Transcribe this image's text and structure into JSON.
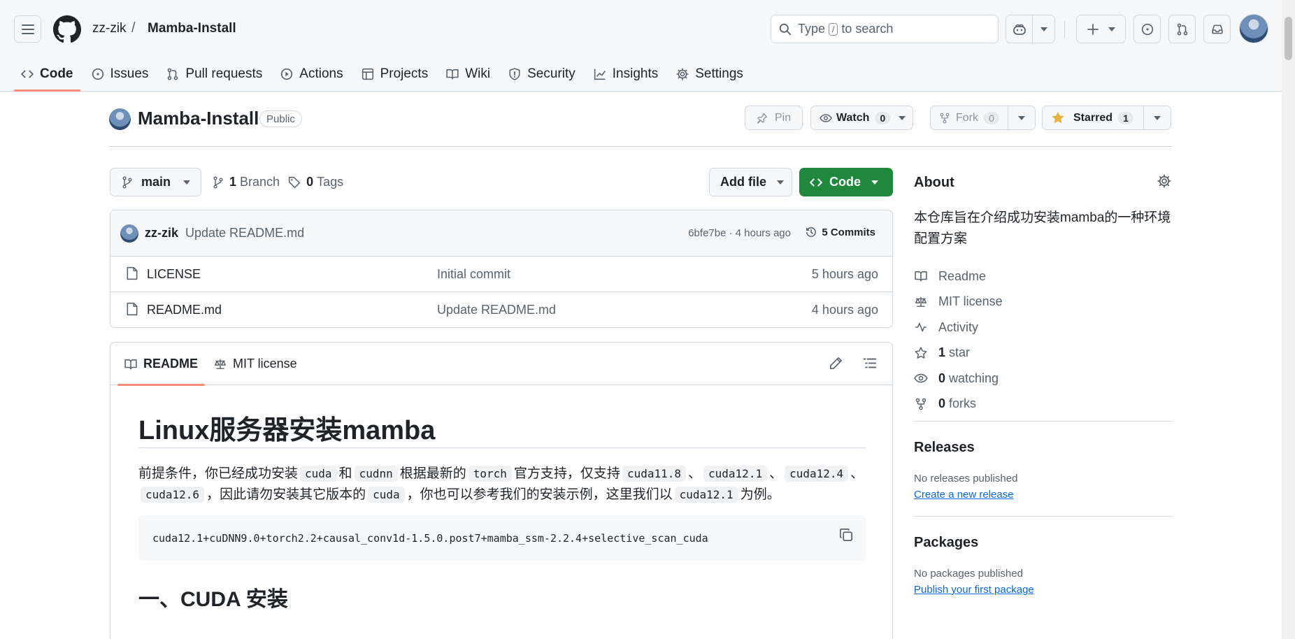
{
  "header": {
    "owner": "zz-zik",
    "separator": "/",
    "repo": "Mamba-Install",
    "search_prefix": "Type",
    "search_key": "/",
    "search_suffix": "to search"
  },
  "tabs": [
    {
      "label": "Code",
      "icon": "code-icon",
      "active": true
    },
    {
      "label": "Issues",
      "icon": "issue-icon"
    },
    {
      "label": "Pull requests",
      "icon": "pull-request-icon"
    },
    {
      "label": "Actions",
      "icon": "play-icon"
    },
    {
      "label": "Projects",
      "icon": "table-icon"
    },
    {
      "label": "Wiki",
      "icon": "book-icon"
    },
    {
      "label": "Security",
      "icon": "shield-icon"
    },
    {
      "label": "Insights",
      "icon": "graph-icon"
    },
    {
      "label": "Settings",
      "icon": "gear-icon"
    }
  ],
  "repo_header": {
    "name": "Mamba-Install",
    "visibility": "Public",
    "pin_label": "Pin",
    "watch_label": "Watch",
    "watch_count": "0",
    "fork_label": "Fork",
    "fork_count": "0",
    "star_label": "Starred",
    "star_count": "1"
  },
  "branch_bar": {
    "branch": "main",
    "branch_count": "1",
    "branch_word": "Branch",
    "tag_count": "0",
    "tag_word": "Tags",
    "add_file_label": "Add file",
    "code_label": "Code"
  },
  "latest_commit": {
    "author": "zz-zik",
    "message": "Update README.md",
    "meta": "6bfe7be · 4 hours ago",
    "commits_label": "5 Commits"
  },
  "files": [
    {
      "name": "LICENSE",
      "message": "Initial commit",
      "age": "5 hours ago"
    },
    {
      "name": "README.md",
      "message": "Update README.md",
      "age": "4 hours ago"
    }
  ],
  "readme": {
    "tab_readme": "README",
    "tab_license": "MIT license",
    "h1": "Linux服务器安装mamba",
    "p": {
      "t1": "前提条件，你已经成功安装",
      "c1": "cuda",
      "t2": "和",
      "c2": "cudnn",
      "t3": "根据最新的",
      "c3": "torch",
      "t4": "官方支持，仅支持",
      "c4": "cuda11.8",
      "t5": "、",
      "c5": "cuda12.1",
      "t6": "、",
      "c6": "cuda12.4",
      "t7": "、",
      "c7": "cuda12.6",
      "t8": "，因此请勿安装其它版本的",
      "c8": "cuda",
      "t9": "，你也可以参考我们的安装示例，这里我们以",
      "c9": "cuda12.1",
      "t10": "为例。"
    },
    "code": "cuda12.1+cuDNN9.0+torch2.2+causal_conv1d-1.5.0.post7+mamba_ssm-2.2.4+selective_scan_cuda",
    "h2": "一、CUDA 安装"
  },
  "about": {
    "title": "About",
    "description": "本仓库旨在介绍成功安装mamba的一种环境配置方案",
    "readme": "Readme",
    "license": "MIT license",
    "activity": "Activity",
    "stars_count": "1",
    "stars_word": "star",
    "watching_count": "0",
    "watching_word": "watching",
    "forks_count": "0",
    "forks_word": "forks"
  },
  "releases": {
    "title": "Releases",
    "empty": "No releases published",
    "link": "Create a new release"
  },
  "packages": {
    "title": "Packages",
    "empty": "No packages published",
    "link": "Publish your first package"
  },
  "colors": {
    "primary_green": "#1f883d",
    "active_underline": "#fd8c73",
    "link_blue": "#0969da",
    "star_yellow": "#e3b341"
  }
}
